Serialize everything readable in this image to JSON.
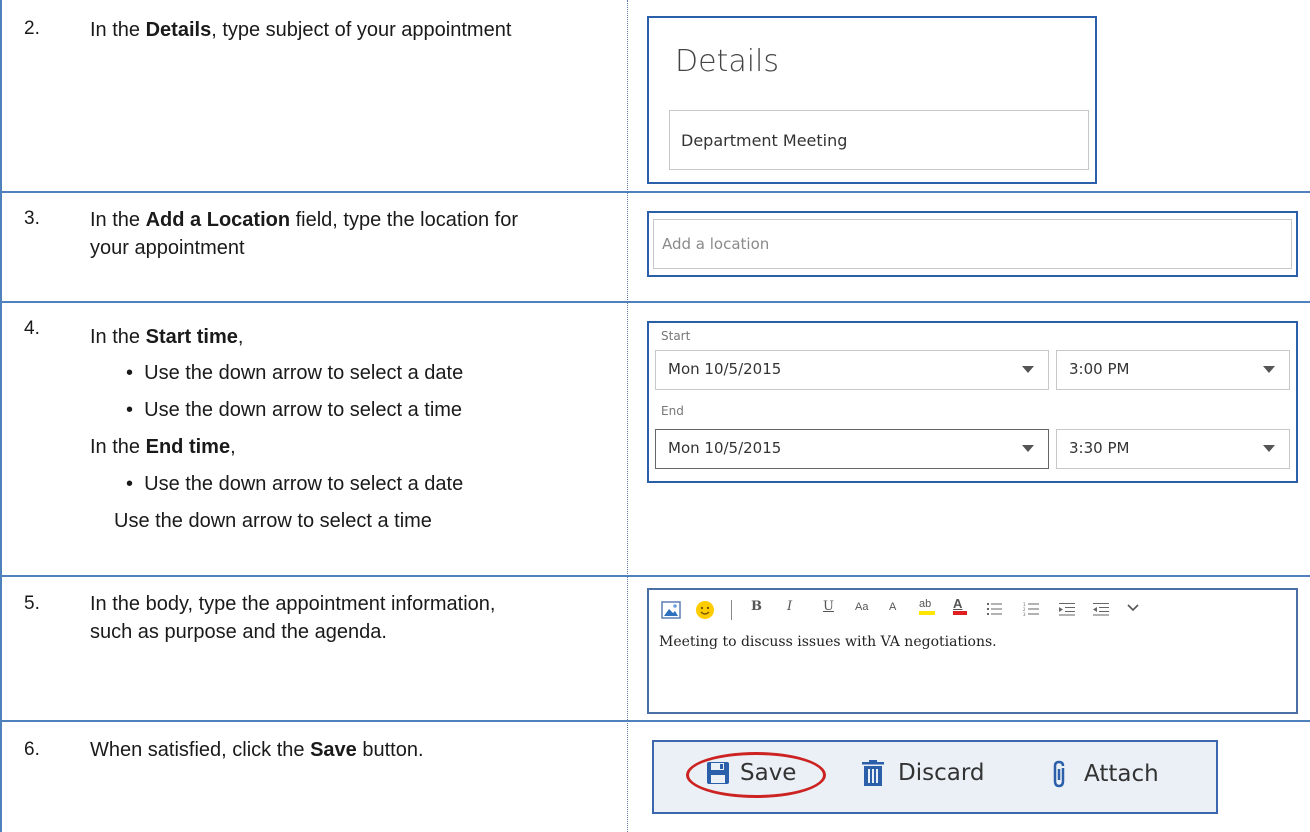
{
  "steps": [
    {
      "number": "2.",
      "pre": "In the ",
      "bold": "Details",
      "post": ", type subject of your appointment"
    },
    {
      "number": "3.",
      "pre": "In the ",
      "bold": "Add a Location",
      "post": " field, type the location for your appointment"
    },
    {
      "number": "4.",
      "pre": "In the ",
      "bold": "Start time",
      "post": ",",
      "bullet1": "Use the down arrow to select a date",
      "bullet2": "Use the down arrow to select a time",
      "end_pre": "In the ",
      "end_bold": "End time",
      "end_post": ",",
      "bullet3": "Use the down arrow to select a date",
      "last_line": "Use the down arrow to select a time"
    },
    {
      "number": "5.",
      "pre": "In the body, type the appointment information, such as purpose and the agenda.",
      "bold": "",
      "post": ""
    },
    {
      "number": "6.",
      "pre": "When satisfied, click the ",
      "bold": "Save",
      "post": " button."
    }
  ],
  "details_panel": {
    "title": "Details",
    "subject_value": "Department Meeting"
  },
  "location_panel": {
    "placeholder": "Add a location"
  },
  "time_panel": {
    "start_label": "Start",
    "start_date": "Mon 10/5/2015",
    "start_time": "3:00 PM",
    "end_label": "End",
    "end_date": "Mon 10/5/2015",
    "end_time": "3:30 PM"
  },
  "body_panel": {
    "toolbar": [
      "insert-picture-icon",
      "emoji-icon",
      "B",
      "I",
      "U",
      "Aa",
      "A",
      "ab",
      "A",
      "bullets-icon",
      "numbering-icon",
      "decrease-indent-icon",
      "increase-indent-icon",
      "more-icon"
    ],
    "body_text": "Meeting to discuss issues with VA negotiations.",
    "highlight_color": "#ffe600",
    "font_color": "#e02020"
  },
  "action_bar": {
    "save_label": "Save",
    "discard_label": "Discard",
    "attach_label": "Attach",
    "accent": "#2b5faa",
    "circle_color": "#cc2222"
  }
}
